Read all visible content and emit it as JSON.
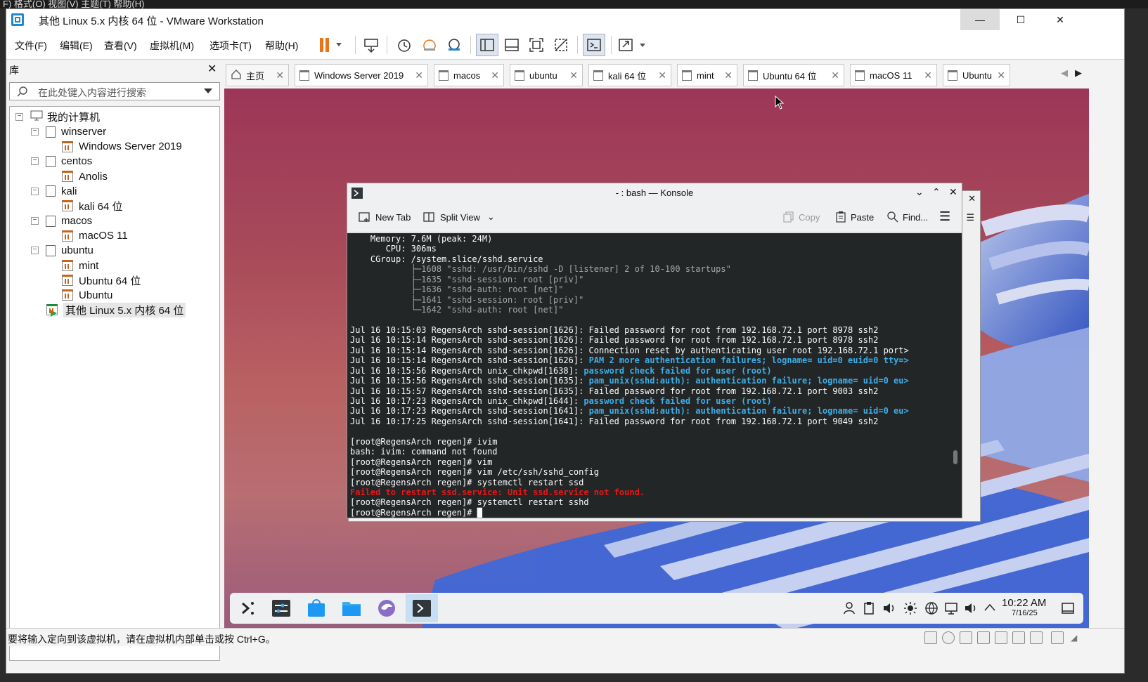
{
  "background_strip": "F)   格式(O)   视图(V)   主题(T)   帮助(H)",
  "window": {
    "title": "其他 Linux 5.x 内核 64 位 - VMware Workstation",
    "minimize": "—",
    "maximize": "☐",
    "close": "✕"
  },
  "menu": [
    "文件(F)",
    "编辑(E)",
    "查看(V)",
    "虚拟机(M)",
    "选项卡(T)",
    "帮助(H)"
  ],
  "library": {
    "title": "库",
    "close": "✕",
    "search_placeholder": "在此处键入内容进行搜索",
    "tree": [
      {
        "label": "我的计算机",
        "level": 0,
        "type": "computer"
      },
      {
        "label": "winserver",
        "level": 1,
        "type": "folder"
      },
      {
        "label": "Windows Server 2019",
        "level": 2,
        "type": "vm"
      },
      {
        "label": "centos",
        "level": 1,
        "type": "folder"
      },
      {
        "label": "Anolis",
        "level": 2,
        "type": "vm"
      },
      {
        "label": "kali",
        "level": 1,
        "type": "folder"
      },
      {
        "label": "kali 64 位",
        "level": 2,
        "type": "vm"
      },
      {
        "label": "macos",
        "level": 1,
        "type": "folder"
      },
      {
        "label": "macOS 11",
        "level": 2,
        "type": "vm"
      },
      {
        "label": "ubuntu",
        "level": 1,
        "type": "folder"
      },
      {
        "label": "mint",
        "level": 2,
        "type": "vm"
      },
      {
        "label": "Ubuntu 64 位",
        "level": 2,
        "type": "vm"
      },
      {
        "label": "Ubuntu",
        "level": 2,
        "type": "vm"
      },
      {
        "label": "其他 Linux 5.x 内核 64 位",
        "level": 1,
        "type": "vm-running"
      }
    ]
  },
  "tabs": [
    "主页",
    "Windows Server 2019",
    "macos",
    "ubuntu",
    "kali 64 位",
    "mint",
    "Ubuntu 64 位",
    "macOS 11",
    "Ubuntu"
  ],
  "konsole": {
    "title": "- : bash — Konsole",
    "new_tab": "New Tab",
    "split_view": "Split View",
    "copy": "Copy",
    "paste": "Paste",
    "find": "Find...",
    "lines": [
      {
        "t": "    Memory: 7.6M (peak: 24M)",
        "c": ""
      },
      {
        "t": "       CPU: 306ms",
        "c": ""
      },
      {
        "t": "    CGroup: /system.slice/sshd.service",
        "c": ""
      },
      {
        "t": "            ├─1608 \"sshd: /usr/bin/sshd -D [listener] 2 of 10-100 startups\"",
        "c": "dim"
      },
      {
        "t": "            ├─1635 \"sshd-session: root [priv]\"",
        "c": "dim"
      },
      {
        "t": "            ├─1636 \"sshd-auth: root [net]\"",
        "c": "dim"
      },
      {
        "t": "            ├─1641 \"sshd-session: root [priv]\"",
        "c": "dim"
      },
      {
        "t": "            └─1642 \"sshd-auth: root [net]\"",
        "c": "dim"
      },
      {
        "t": "",
        "c": ""
      },
      {
        "t": "Jul 16 10:15:03 RegensArch sshd-session[1626]: Failed password for root from 192.168.72.1 port 8978 ssh2",
        "c": ""
      },
      {
        "t": "Jul 16 10:15:14 RegensArch sshd-session[1626]: Failed password for root from 192.168.72.1 port 8978 ssh2",
        "c": ""
      },
      {
        "t": "Jul 16 10:15:14 RegensArch sshd-session[1626]: Connection reset by authenticating user root 192.168.72.1 port>",
        "c": ""
      },
      {
        "p": "Jul 16 10:15:14 RegensArch sshd-session[1626]: ",
        "t": "PAM 2 more authentication failures; logname= uid=0 euid=0 tty=>",
        "c": "blue"
      },
      {
        "p": "Jul 16 10:15:56 RegensArch unix_chkpwd[1638]: ",
        "t": "password check failed for user (root)",
        "c": "blue"
      },
      {
        "p": "Jul 16 10:15:56 RegensArch sshd-session[1635]: ",
        "t": "pam_unix(sshd:auth): authentication failure; logname= uid=0 eu>",
        "c": "blue"
      },
      {
        "t": "Jul 16 10:15:57 RegensArch sshd-session[1635]: Failed password for root from 192.168.72.1 port 9003 ssh2",
        "c": ""
      },
      {
        "p": "Jul 16 10:17:23 RegensArch unix_chkpwd[1644]: ",
        "t": "password check failed for user (root)",
        "c": "blue"
      },
      {
        "p": "Jul 16 10:17:23 RegensArch sshd-session[1641]: ",
        "t": "pam_unix(sshd:auth): authentication failure; logname= uid=0 eu>",
        "c": "blue"
      },
      {
        "t": "Jul 16 10:17:25 RegensArch sshd-session[1641]: Failed password for root from 192.168.72.1 port 9049 ssh2",
        "c": ""
      },
      {
        "t": "",
        "c": ""
      },
      {
        "t": "[root@RegensArch regen]# ivim",
        "c": ""
      },
      {
        "t": "bash: ivim: command not found",
        "c": ""
      },
      {
        "t": "[root@RegensArch regen]# vim",
        "c": ""
      },
      {
        "t": "[root@RegensArch regen]# vim /etc/ssh/sshd_config",
        "c": ""
      },
      {
        "t": "[root@RegensArch regen]# systemctl restart ssd",
        "c": ""
      },
      {
        "t": "Failed to restart ssd.service: Unit ssd.service not found.",
        "c": "red"
      },
      {
        "t": "[root@RegensArch regen]# systemctl restart sshd",
        "c": ""
      },
      {
        "t": "[root@RegensArch regen]# █",
        "c": ""
      }
    ]
  },
  "clock": {
    "time": "10:22 AM",
    "date": "7/16/25"
  },
  "status": "要将输入定向到该虚拟机，请在虚拟机内部单击或按 Ctrl+G。"
}
